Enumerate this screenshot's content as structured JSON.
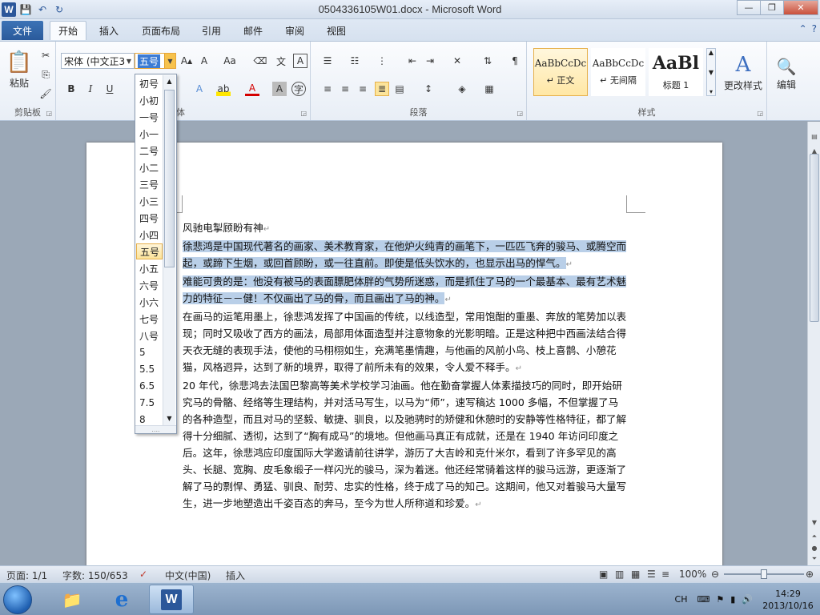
{
  "window": {
    "title": "0504336105W01.docx  -  Microsoft Word",
    "controls": {
      "minimize": "—",
      "maximize": "❐",
      "close": "✕"
    }
  },
  "qat": {
    "logo": "W",
    "save": "💾",
    "undo": "↶",
    "redo": "↻"
  },
  "tabs": [
    {
      "label": "文件"
    },
    {
      "label": "开始"
    },
    {
      "label": "插入"
    },
    {
      "label": "页面布局"
    },
    {
      "label": "引用"
    },
    {
      "label": "邮件"
    },
    {
      "label": "审阅"
    },
    {
      "label": "视图"
    }
  ],
  "ribbon": {
    "clipboard": {
      "paste_label": "粘贴",
      "group_label": "剪贴板"
    },
    "font": {
      "name": "宋体 (中文正3",
      "size": "五号",
      "group_label": "体"
    },
    "paragraph": {
      "group_label": "段落"
    },
    "styles": {
      "group_label": "样式",
      "items": [
        {
          "sample": "AaBbCcDc",
          "name": "↵ 正文"
        },
        {
          "sample": "AaBbCcDc",
          "name": "↵ 无间隔"
        },
        {
          "sample": "AaBl",
          "name": "标题 1"
        }
      ],
      "change_styles": "更改样式"
    },
    "editing": {
      "label": "编辑"
    }
  },
  "size_list": {
    "items": [
      "初号",
      "小初",
      "一号",
      "小一",
      "二号",
      "小二",
      "三号",
      "小三",
      "四号",
      "小四",
      "五号",
      "小五",
      "六号",
      "小六",
      "七号",
      "八号",
      "5",
      "5.5",
      "6.5",
      "7.5",
      "8"
    ],
    "selected": "五号"
  },
  "document": {
    "heading": "风驰电掣顾盼有神",
    "p1": "徐悲鸿是中国现代著名的画家、美术教育家，在他炉火纯青的画笔下，一匹匹飞奔的骏马、或腾空而起，或蹄下生烟，或回首顾盼，或一往直前。即使是低头饮水的，也显示出马的悍气。",
    "p2": "难能可贵的是：他没有被马的表面膘肥体胖的气势所迷惑，而是抓住了马的一个最基本、最有艺术魅力的特征－－健！不仅画出了马的骨，而且画出了马的神。",
    "p3": "在画马的运笔用墨上，徐悲鸿发挥了中国画的传统，以线造型，常用饱酣的重墨、奔放的笔势加以表现；同时又吸收了西方的画法，局部用体面造型并注意物象的光影明暗。正是这种把中西画法结合得天衣无缝的表现手法，使他的马栩栩如生，充满笔墨情趣，与他画的风前小鸟、枝上喜鹊、小憩花猫，风格迥异，达到了新的境界，取得了前所未有的效果，令人爱不释手。",
    "p4": "20 年代，徐悲鸿去法国巴黎高等美术学校学习油画。他在勤奋掌握人体素描技巧的同时，即开始研究马的骨骼、经络等生理结构，并对活马写生，以马为“师”，速写稿达 1000 多幅，不但掌握了马的各种造型，而且对马的坚毅、敏捷、驯良，以及驰骋时的矫健和休憩时的安静等性格特征，都了解得十分细腻、透彻，达到了“胸有成马”的境地。但他画马真正有成就，还是在 1940 年访问印度之后。这年，徐悲鸿应印度国际大学邀请前往讲学，游历了大吉岭和克什米尔，看到了许多罕见的高头、长腿、宽胸、皮毛象缎子一样闪光的骏马，深为着迷。他还经常骑着这样的骏马远游，更逐渐了解了马的剽悍、勇猛、驯良、耐劳、忠实的性格，终于成了马的知己。这期间，他又对着骏马大量写生，进一步地塑造出千姿百态的奔马，至今为世人所称道和珍爱。",
    "para_mark": "↵"
  },
  "status": {
    "page": "页面: 1/1",
    "words": "字数: 150/653",
    "language": "中文(中国)",
    "insert": "插入",
    "zoom": "100%",
    "zoom_level": 0.5
  },
  "taskbar": {
    "tray_lang": "CH",
    "time": "14:29",
    "date": "2013/10/16"
  }
}
